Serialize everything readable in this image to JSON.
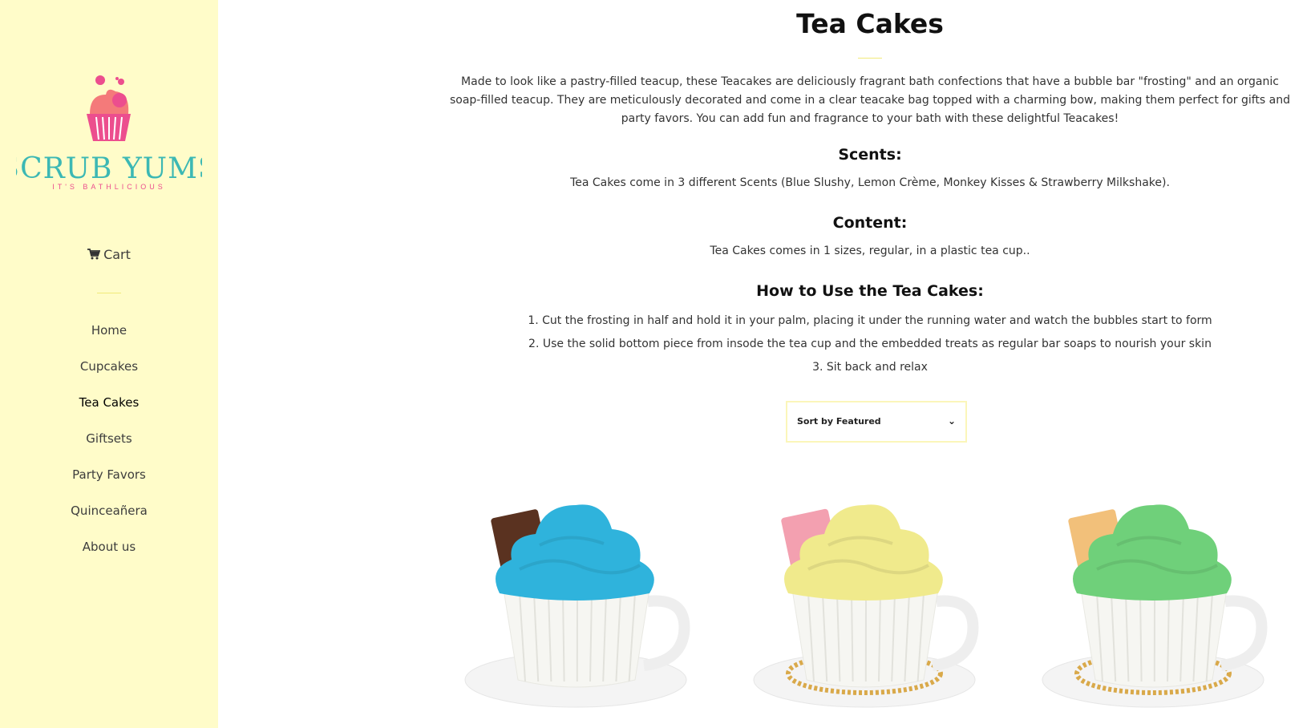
{
  "brand": {
    "name": "SCRUB YUMS",
    "tagline": "IT'S BATHLICIOUS"
  },
  "sidebar": {
    "cart_label": "Cart",
    "nav": [
      {
        "label": "Home",
        "active": false
      },
      {
        "label": "Cupcakes",
        "active": false
      },
      {
        "label": "Tea Cakes",
        "active": true
      },
      {
        "label": "Giftsets",
        "active": false
      },
      {
        "label": "Party Favors",
        "active": false
      },
      {
        "label": "Quinceañera",
        "active": false
      },
      {
        "label": "About us",
        "active": false
      }
    ]
  },
  "main": {
    "title": "Tea Cakes",
    "intro": "Made to look like a pastry-filled teacup, these Teacakes are deliciously fragrant bath confections that have a bubble bar \"frosting\" and an organic soap-filled teacup. They are meticulously decorated and come in a clear teacake bag topped with a charming bow, making them perfect for gifts and party favors. You can add fun and fragrance to your bath with these delightful Teacakes!",
    "scents_heading": "Scents:",
    "scents_text": "Tea Cakes come in 3 different Scents (Blue Slushy, Lemon Crème, Monkey Kisses & Strawberry Milkshake).",
    "content_heading": "Content:",
    "content_text": "Tea Cakes comes in 1 sizes, regular, in a plastic tea cup..",
    "howto_heading": "How to Use the Tea Cakes:",
    "steps": [
      "1. Cut the frosting in half and hold it in your palm, placing it under the running water and watch the bubbles start to form",
      "2. Use the solid bottom piece from insode the tea cup and the embedded treats as regular bar soaps to nourish your skin",
      "3. Sit back and relax"
    ],
    "sort": {
      "selected": "Sort by Featured",
      "chevron": "⌄"
    }
  },
  "products": [
    {
      "frosting_color": "#2fb3dc",
      "chocolate_color": "#5a3220"
    },
    {
      "frosting_color": "#f0ea8c",
      "chocolate_color": "#f3a0b0"
    },
    {
      "frosting_color": "#6fd07a",
      "chocolate_color": "#f2c07a"
    }
  ],
  "colors": {
    "sidebar_bg": "#fffcc9",
    "accent_yellow": "#f1ea7a",
    "logo_teal": "#3cb8b4",
    "logo_pink": "#ec4e8e"
  }
}
